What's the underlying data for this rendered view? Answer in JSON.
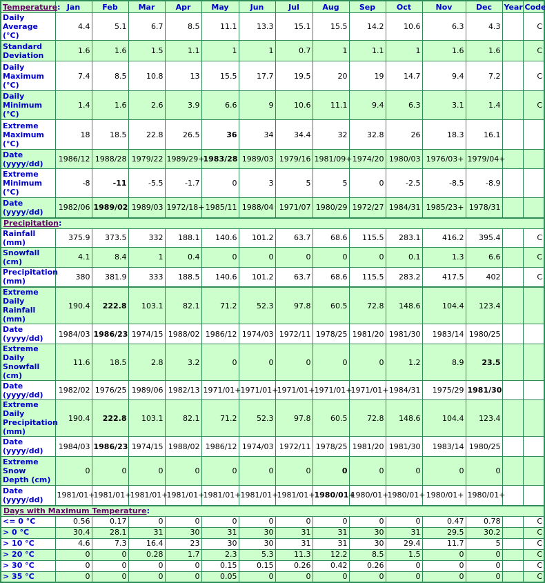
{
  "columns": [
    "Jan",
    "Feb",
    "Mar",
    "Apr",
    "May",
    "Jun",
    "Jul",
    "Aug",
    "Sep",
    "Oct",
    "Nov",
    "Dec",
    "Year",
    "Code"
  ],
  "sections": {
    "temperature": {
      "label": "Temperature",
      "colon": ":",
      "rows": [
        {
          "label": "Daily Average (°C)",
          "values": [
            "4.4",
            "5.1",
            "6.7",
            "8.5",
            "11.1",
            "13.3",
            "15.1",
            "15.5",
            "14.2",
            "10.6",
            "6.3",
            "4.3",
            "",
            "C"
          ],
          "bold": []
        },
        {
          "label": "Standard Deviation",
          "values": [
            "1.6",
            "1.6",
            "1.5",
            "1.1",
            "1",
            "1",
            "0.7",
            "1",
            "1.1",
            "1",
            "1.6",
            "1.6",
            "",
            "C"
          ],
          "bold": []
        },
        {
          "label": "Daily Maximum (°C)",
          "values": [
            "7.4",
            "8.5",
            "10.8",
            "13",
            "15.5",
            "17.7",
            "19.5",
            "20",
            "19",
            "14.7",
            "9.4",
            "7.2",
            "",
            "C"
          ],
          "bold": []
        },
        {
          "label": "Daily Minimum (°C)",
          "values": [
            "1.4",
            "1.6",
            "2.6",
            "3.9",
            "6.6",
            "9",
            "10.6",
            "11.1",
            "9.4",
            "6.3",
            "3.1",
            "1.4",
            "",
            "C"
          ],
          "bold": []
        },
        {
          "label": "Extreme Maximum (°C)",
          "values": [
            "18",
            "18.5",
            "22.8",
            "26.5",
            "36",
            "34",
            "34.4",
            "32",
            "32.8",
            "26",
            "18.3",
            "16.1",
            "",
            ""
          ],
          "bold": [
            4
          ]
        },
        {
          "label": "Date (yyyy/dd)",
          "values": [
            "1986/12",
            "1988/28",
            "1979/22",
            "1989/29+",
            "1983/28",
            "1989/03",
            "1979/16",
            "1981/09+",
            "1974/20",
            "1980/03",
            "1976/03+",
            "1979/04+",
            "",
            ""
          ],
          "bold": [
            4
          ]
        },
        {
          "label": "Extreme Minimum (°C)",
          "values": [
            "-8",
            "-11",
            "-5.5",
            "-1.7",
            "0",
            "3",
            "5",
            "5",
            "0",
            "-2.5",
            "-8.5",
            "-8.9",
            "",
            ""
          ],
          "bold": [
            1
          ]
        },
        {
          "label": "Date (yyyy/dd)",
          "values": [
            "1982/06",
            "1989/02",
            "1989/03",
            "1972/18+",
            "1985/11",
            "1988/04",
            "1971/07",
            "1980/29",
            "1972/27",
            "1984/31",
            "1985/23+",
            "1978/31",
            "",
            ""
          ],
          "bold": [
            1
          ]
        }
      ]
    },
    "precipitation": {
      "label": "Precipitation",
      "colon": ":",
      "rows": [
        {
          "label": "Rainfall (mm)",
          "values": [
            "375.9",
            "373.5",
            "332",
            "188.1",
            "140.6",
            "101.2",
            "63.7",
            "68.6",
            "115.5",
            "283.1",
            "416.2",
            "395.4",
            "",
            "C"
          ],
          "bold": []
        },
        {
          "label": "Snowfall (cm)",
          "values": [
            "4.1",
            "8.4",
            "1",
            "0.4",
            "0",
            "0",
            "0",
            "0",
            "0",
            "0.1",
            "1.3",
            "6.6",
            "",
            "C"
          ],
          "bold": []
        },
        {
          "label": "Precipitation (mm)",
          "values": [
            "380",
            "381.9",
            "333",
            "188.5",
            "140.6",
            "101.2",
            "63.7",
            "68.6",
            "115.5",
            "283.2",
            "417.5",
            "402",
            "",
            "C"
          ],
          "bold": []
        },
        {
          "label": "Extreme Daily Rainfall (mm)",
          "values": [
            "190.4",
            "222.8",
            "103.1",
            "82.1",
            "71.2",
            "52.3",
            "97.8",
            "60.5",
            "72.8",
            "148.6",
            "104.4",
            "123.4",
            "",
            ""
          ],
          "bold": [
            1
          ]
        },
        {
          "label": "Date (yyyy/dd)",
          "values": [
            "1984/03",
            "1986/23",
            "1974/15",
            "1988/02",
            "1986/12",
            "1974/03",
            "1972/11",
            "1978/25",
            "1981/20",
            "1981/30",
            "1983/14",
            "1980/25",
            "",
            ""
          ],
          "bold": [
            1
          ]
        },
        {
          "label": "Extreme Daily Snowfall (cm)",
          "values": [
            "11.6",
            "18.5",
            "2.8",
            "3.2",
            "0",
            "0",
            "0",
            "0",
            "0",
            "1.2",
            "8.9",
            "23.5",
            "",
            ""
          ],
          "bold": [
            11
          ]
        },
        {
          "label": "Date (yyyy/dd)",
          "values": [
            "1982/02",
            "1976/25",
            "1989/06",
            "1982/13",
            "1971/01+",
            "1971/01+",
            "1971/01+",
            "1971/01+",
            "1971/01+",
            "1984/31",
            "1975/29",
            "1981/30",
            "",
            ""
          ],
          "bold": [
            11
          ]
        },
        {
          "label": "Extreme Daily Precipitation (mm)",
          "values": [
            "190.4",
            "222.8",
            "103.1",
            "82.1",
            "71.2",
            "52.3",
            "97.8",
            "60.5",
            "72.8",
            "148.6",
            "104.4",
            "123.4",
            "",
            ""
          ],
          "bold": [
            1
          ]
        },
        {
          "label": "Date (yyyy/dd)",
          "values": [
            "1984/03",
            "1986/23",
            "1974/15",
            "1988/02",
            "1986/12",
            "1974/03",
            "1972/11",
            "1978/25",
            "1981/20",
            "1981/30",
            "1983/14",
            "1980/25",
            "",
            ""
          ],
          "bold": [
            1
          ]
        },
        {
          "label": "Extreme Snow Depth (cm)",
          "values": [
            "0",
            "0",
            "0",
            "0",
            "0",
            "0",
            "0",
            "0",
            "0",
            "0",
            "0",
            "0",
            "",
            ""
          ],
          "bold": [
            7
          ]
        },
        {
          "label": "Date (yyyy/dd)",
          "values": [
            "1981/01+",
            "1981/01+",
            "1981/01+",
            "1981/01+",
            "1981/01+",
            "1981/01+",
            "1981/01+",
            "1980/01+",
            "1980/01+",
            "1980/01+",
            "1980/01+",
            "1980/01+",
            "",
            ""
          ],
          "bold": [
            7
          ]
        }
      ]
    },
    "days_max_temp": {
      "label": "Days with Maximum Temperature",
      "colon": ":",
      "rows": [
        {
          "label": "<= 0 °C",
          "values": [
            "0.56",
            "0.17",
            "0",
            "0",
            "0",
            "0",
            "0",
            "0",
            "0",
            "0",
            "0.47",
            "0.78",
            "",
            "C"
          ],
          "bold": []
        },
        {
          "label": "> 0 °C",
          "values": [
            "30.4",
            "28.1",
            "31",
            "30",
            "31",
            "30",
            "31",
            "31",
            "30",
            "31",
            "29.5",
            "30.2",
            "",
            "C"
          ],
          "bold": []
        },
        {
          "label": "> 10 °C",
          "values": [
            "4.6",
            "7.3",
            "16.4",
            "23",
            "30",
            "30",
            "31",
            "31",
            "30",
            "29.4",
            "11.7",
            "5",
            "",
            "C"
          ],
          "bold": []
        },
        {
          "label": "> 20 °C",
          "values": [
            "0",
            "0",
            "0.28",
            "1.7",
            "2.3",
            "5.3",
            "11.3",
            "12.2",
            "8.5",
            "1.5",
            "0",
            "0",
            "",
            "C"
          ],
          "bold": []
        },
        {
          "label": "> 30 °C",
          "values": [
            "0",
            "0",
            "0",
            "0",
            "0.15",
            "0.15",
            "0.26",
            "0.42",
            "0.26",
            "0",
            "0",
            "0",
            "",
            "C"
          ],
          "bold": []
        },
        {
          "label": "> 35 °C",
          "values": [
            "0",
            "0",
            "0",
            "0",
            "0.05",
            "0",
            "0",
            "0",
            "0",
            "0",
            "0",
            "0",
            "",
            "C"
          ],
          "bold": []
        }
      ]
    }
  },
  "colors": {
    "border": "#2e8b57",
    "alt_row_bg": "#ccffcc",
    "header_text": "#0000cc",
    "section_link": "#660066"
  }
}
